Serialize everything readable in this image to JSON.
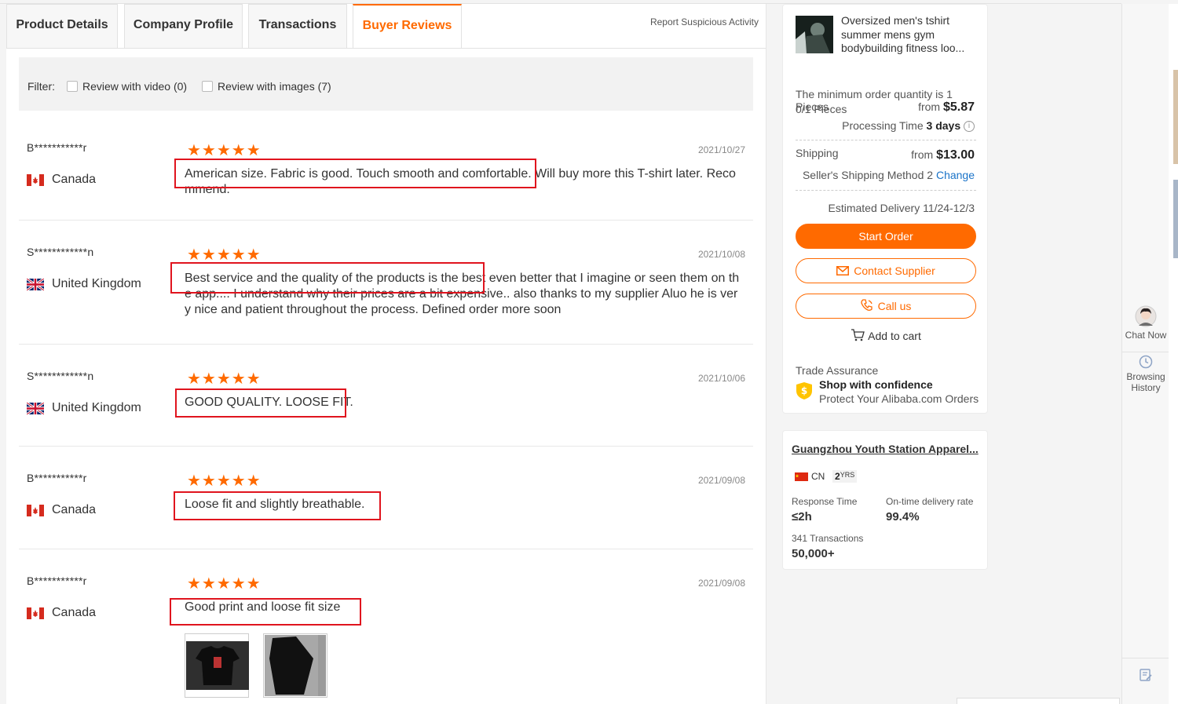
{
  "tabs": [
    {
      "label": "Product Details"
    },
    {
      "label": "Company Profile"
    },
    {
      "label": "Transactions"
    },
    {
      "label": "Buyer Reviews"
    }
  ],
  "report_link": "Report Suspicious Activity",
  "filter": {
    "label": "Filter:",
    "option_video": "Review with video (0)",
    "option_images": "Review with images (7)"
  },
  "reviews": [
    {
      "name": "B***********r",
      "country": "Canada",
      "stars": "★★★★★",
      "date": "2021/10/27",
      "text": "American size. Fabric is good. Touch smooth and comfortable. Will buy more this T-shirt later. Recommend."
    },
    {
      "name": "S************n",
      "country": "United Kingdom",
      "stars": "★★★★★",
      "date": "2021/10/08",
      "text": "Best service and the quality of the products is the best even better that I imagine or seen them on the app.... I understand why their prices are a bit expensive.. also thanks to my supplier Aluo he is very nice and patient throughout the process. Defined order more soon"
    },
    {
      "name": "S************n",
      "country": "United Kingdom",
      "stars": "★★★★★",
      "date": "2021/10/06",
      "text": "GOOD QUALITY. LOOSE FIT."
    },
    {
      "name": "B***********r",
      "country": "Canada",
      "stars": "★★★★★",
      "date": "2021/09/08",
      "text": "Loose fit and slightly breathable."
    },
    {
      "name": "B***********r",
      "country": "Canada",
      "stars": "★★★★★",
      "date": "2021/09/08",
      "text": "Good print and loose fit size"
    }
  ],
  "order": {
    "product_title": "Oversized men's tshirt summer mens gym bodybuilding fitness loo...",
    "moq_text": "The minimum order quantity is 1 Pieces",
    "pieces": "0/1 Pieces",
    "price_from": "from",
    "price": "$5.87",
    "processing_label": "Processing Time",
    "processing_value": "3 days",
    "shipping_label": "Shipping",
    "shipping_from": "from",
    "shipping_price": "$13.00",
    "shipping_method": "Seller's Shipping Method 2",
    "change_label": "Change",
    "delivery_label": "Estimated Delivery",
    "delivery_value": "11/24-12/3",
    "start_order": "Start Order",
    "contact_supplier": "Contact Supplier",
    "call_us": "Call us",
    "add_to_cart": "Add to cart",
    "trade_assurance": "Trade Assurance",
    "shop_confidence": "Shop with confidence",
    "protect_text": "Protect Your Alibaba.com Orders"
  },
  "supplier": {
    "name": "Guangzhou Youth Station Apparel...",
    "country": "CN",
    "years": "2",
    "years_unit": "YRS",
    "response_label": "Response Time",
    "response_value": "≤2h",
    "ontime_label": "On-time delivery rate",
    "ontime_value": "99.4%",
    "transactions_label": "341 Transactions",
    "transactions_value": "50,000+"
  },
  "sidebar": {
    "chat_now": "Chat Now",
    "browsing_history_1": "Browsing",
    "browsing_history_2": "History"
  },
  "colors": {
    "accent": "#ff6a00",
    "highlight": "#e0141e",
    "link": "#1a73c8"
  }
}
